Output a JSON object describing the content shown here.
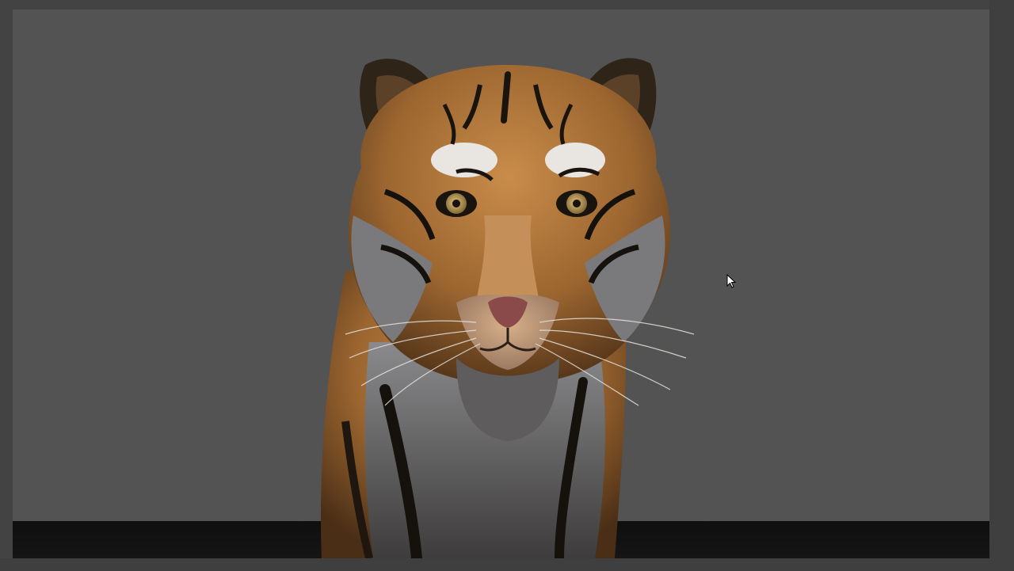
{
  "viewport": {
    "background_color": "#535353",
    "floor_color": "#121212",
    "frame_color": "#434343"
  },
  "render": {
    "subject": "tiger-head-render",
    "fur_color": "#b5793c",
    "stripe_color": "#1a140f",
    "eye_color": "#c9a35a",
    "nose_color": "#8a4a4a"
  },
  "cursor": {
    "icon": "arrow-cursor-icon"
  }
}
